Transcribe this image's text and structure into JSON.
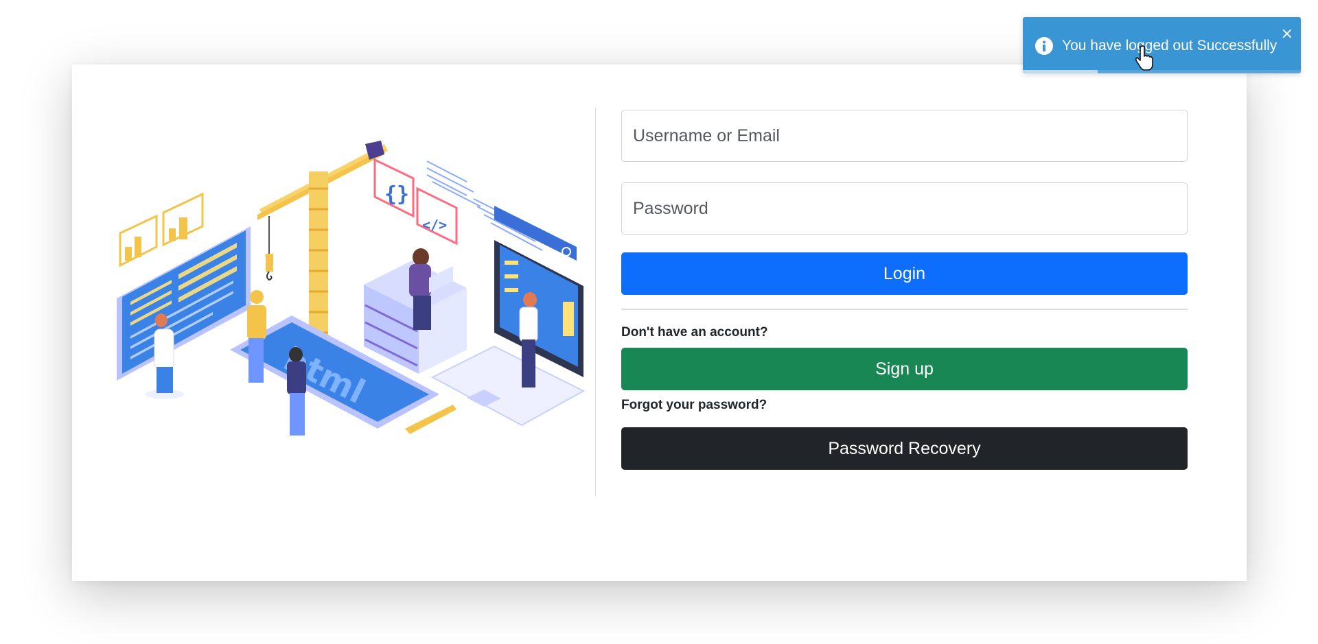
{
  "login_form": {
    "username_placeholder": "Username or Email",
    "password_placeholder": "Password",
    "login_label": "Login",
    "no_account_text": "Don't have an account?",
    "signup_label": "Sign up",
    "forgot_text": "Forgot your password?",
    "recovery_label": "Password Recovery"
  },
  "toast": {
    "message": "You have logged out Successfully",
    "close_symbol": "×",
    "icon": "info-icon",
    "progress_fraction": 0.27
  },
  "illustration": {
    "icon": "web-development-illustration",
    "screen_text": "html"
  },
  "colors": {
    "login": "#0d6efd",
    "signup": "#198754",
    "recovery": "#212529",
    "toast": "#3a95d4"
  }
}
